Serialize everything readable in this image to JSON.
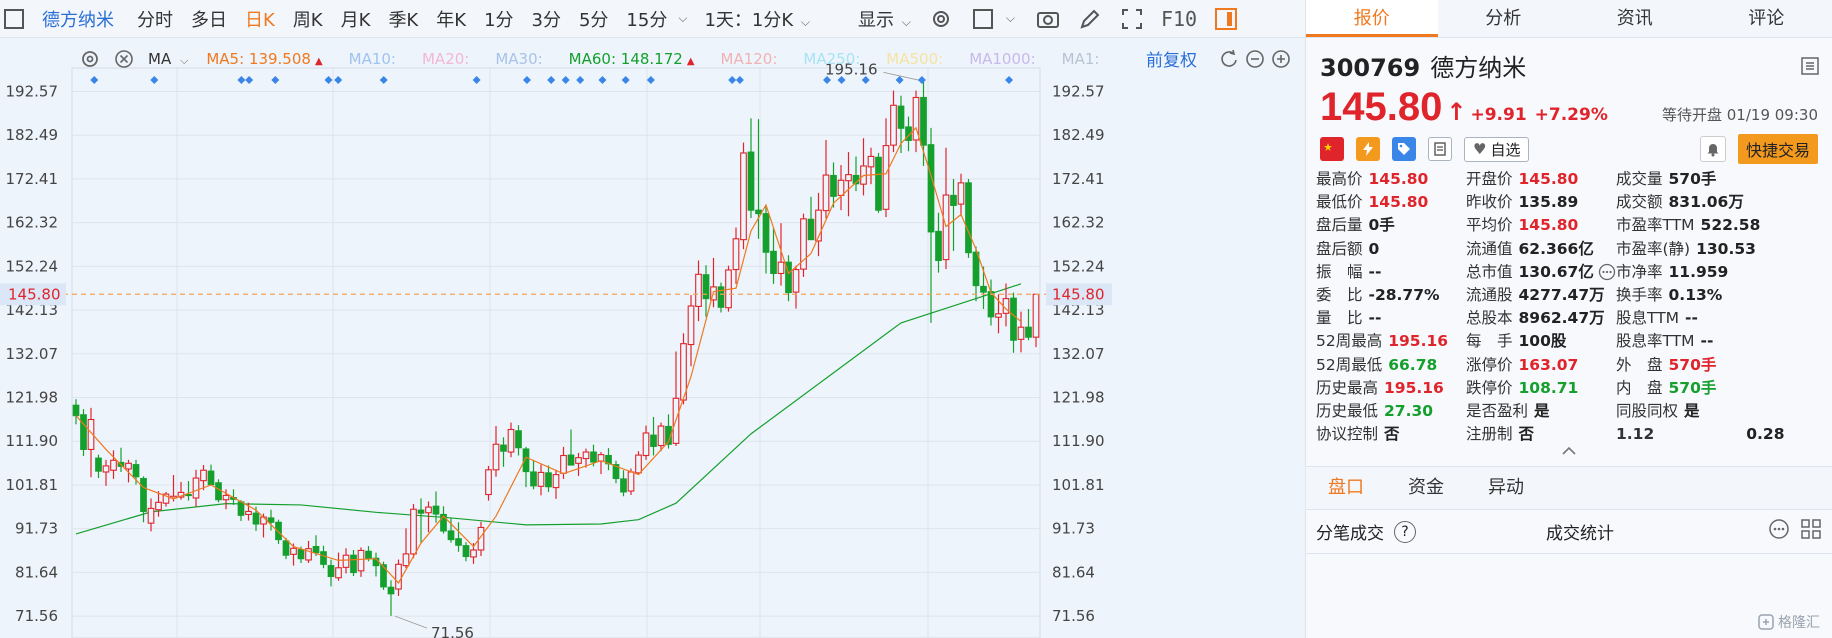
{
  "toolbar": {
    "stock_name": "德方纳米",
    "periods": [
      "分时",
      "多日",
      "日K",
      "周K",
      "月K",
      "季K",
      "年K",
      "1分",
      "3分",
      "5分",
      "15分"
    ],
    "active_period": "日K",
    "range_select": "1天：1分K",
    "display_label": "显示",
    "f10_label": "F10"
  },
  "ma_bar": {
    "indicator": "MA",
    "items": [
      {
        "label": "MA5: 139.508",
        "color": "#f0791f",
        "up": true
      },
      {
        "label": "MA10:",
        "color": "#9fc3f0"
      },
      {
        "label": "MA20:",
        "color": "#f2b6d9"
      },
      {
        "label": "MA30:",
        "color": "#a8c3e8"
      },
      {
        "label": "MA60: 148.172",
        "color": "#15a02e",
        "up": true
      },
      {
        "label": "MA120:",
        "color": "#f0b3b3"
      },
      {
        "label": "MA250:",
        "color": "#a6e3f5"
      },
      {
        "label": "MA500:",
        "color": "#f5e3a0"
      },
      {
        "label": "MA1000:",
        "color": "#c8b8ec"
      },
      {
        "label": "MA1:",
        "color": "#b8c4d4"
      }
    ],
    "fq_label": "前复权"
  },
  "chart_data": {
    "type": "candlestick",
    "y_ticks": [
      "192.57",
      "182.49",
      "172.41",
      "162.32",
      "152.24",
      "142.13",
      "132.07",
      "121.98",
      "111.90",
      "101.81",
      "91.73",
      "81.64",
      "71.56"
    ],
    "ylim": [
      66.5,
      198
    ],
    "current_price": "145.80",
    "annotations": [
      {
        "text": "195.16",
        "value": 195.16
      },
      {
        "text": "71.56",
        "value": 71.56
      }
    ],
    "ohlc": [
      [
        120.2,
        121.6,
        115.8,
        117.8
      ],
      [
        118,
        119.3,
        108.5,
        110
      ],
      [
        110,
        119.6,
        103.6,
        116.9
      ],
      [
        108,
        108.8,
        103.4,
        105
      ],
      [
        104.8,
        107.6,
        101.6,
        106.2
      ],
      [
        105.2,
        109.8,
        103.2,
        107.5
      ],
      [
        107,
        110.4,
        104.8,
        106.1
      ],
      [
        105.5,
        107.6,
        102.4,
        106.8
      ],
      [
        106.5,
        107.6,
        101.9,
        103.7
      ],
      [
        103.3,
        103.8,
        93.2,
        95.7
      ],
      [
        93,
        98.7,
        91.1,
        96.4
      ],
      [
        96.1,
        100.4,
        94.5,
        97.8
      ],
      [
        97.6,
        100.2,
        96.8,
        99.7
      ],
      [
        98.8,
        104.1,
        98,
        99.2
      ],
      [
        99,
        102.5,
        98.4,
        100.1
      ],
      [
        99.6,
        102.7,
        98.2,
        99.5
      ],
      [
        98.8,
        105.3,
        96.8,
        103.4
      ],
      [
        102.8,
        106.4,
        100.6,
        105.2
      ],
      [
        105,
        106.5,
        102.6,
        101.9
      ],
      [
        102.3,
        103.1,
        97.8,
        98.4
      ],
      [
        98.4,
        100.8,
        96.2,
        99.4
      ],
      [
        98.9,
        100.8,
        97.2,
        98.5
      ],
      [
        97.9,
        98.3,
        93.5,
        94.8
      ],
      [
        95,
        97.7,
        93.6,
        95.7
      ],
      [
        95.3,
        96.8,
        91.2,
        92.8
      ],
      [
        92.8,
        95.2,
        89.7,
        94.4
      ],
      [
        94.2,
        96.1,
        91.3,
        93.2
      ],
      [
        93.2,
        93.8,
        88.2,
        89.2
      ],
      [
        88.9,
        89.6,
        84.7,
        85.6
      ],
      [
        85.8,
        88.3,
        83.2,
        87.2
      ],
      [
        86.9,
        87.6,
        83.8,
        84.8
      ],
      [
        84.5,
        88.9,
        83.8,
        87.1
      ],
      [
        87.6,
        90.2,
        85.4,
        86.2
      ],
      [
        86.4,
        87.8,
        82.6,
        83.5
      ],
      [
        83.2,
        84.6,
        78.4,
        80.7
      ],
      [
        80.4,
        86.2,
        79.7,
        82.7
      ],
      [
        82.8,
        87.2,
        81.4,
        85.6
      ],
      [
        85.6,
        86.8,
        80.8,
        81.6
      ],
      [
        82,
        87.4,
        80.6,
        86.7
      ],
      [
        86.5,
        87.7,
        84.2,
        84.8
      ],
      [
        84.9,
        86.2,
        80.7,
        83.2
      ],
      [
        83.4,
        84.1,
        77.6,
        78.3
      ],
      [
        78.2,
        79.8,
        71.6,
        76.7
      ],
      [
        77.8,
        84.6,
        76.2,
        83.5
      ],
      [
        83.2,
        91.8,
        82.6,
        85.9
      ],
      [
        85.9,
        97.4,
        84.9,
        96.2
      ],
      [
        96,
        98.7,
        88.5,
        95.3
      ],
      [
        95.4,
        98,
        90.9,
        96.7
      ],
      [
        96.9,
        100.3,
        93.1,
        95.1
      ],
      [
        95,
        96.9,
        90.6,
        91.2
      ],
      [
        91.2,
        94.1,
        88.5,
        89.2
      ],
      [
        89.4,
        93.2,
        86.4,
        87.9
      ],
      [
        87.8,
        88.6,
        84.2,
        85.3
      ],
      [
        85.2,
        88.4,
        83.6,
        86.8
      ],
      [
        86.8,
        93.3,
        85.4,
        92
      ],
      [
        99.6,
        106.2,
        98.2,
        105.3
      ],
      [
        105.3,
        115.4,
        103.7,
        111.2
      ],
      [
        111,
        112.8,
        106,
        109.6
      ],
      [
        109.4,
        116.2,
        108.2,
        114.6
      ],
      [
        114.3,
        115.6,
        108.6,
        110.4
      ],
      [
        110.1,
        110.6,
        101.3,
        104.9
      ],
      [
        104.8,
        107.6,
        100.8,
        101.6
      ],
      [
        101.5,
        106.5,
        99.4,
        104.7
      ],
      [
        104.6,
        106.3,
        100.2,
        101.4
      ],
      [
        101.2,
        105.3,
        98.6,
        104.2
      ],
      [
        104.5,
        110.6,
        103.2,
        108.6
      ],
      [
        108.7,
        114.6,
        107.2,
        106.4
      ],
      [
        106.8,
        109.2,
        103.9,
        108.1
      ],
      [
        107.9,
        110.2,
        105.8,
        109.4
      ],
      [
        109.4,
        111.1,
        106.1,
        107.1
      ],
      [
        107.3,
        109.4,
        104.3,
        108.8
      ],
      [
        108.6,
        110.3,
        105.2,
        106.7
      ],
      [
        106.5,
        107.4,
        102.2,
        103.3
      ],
      [
        103.2,
        105.2,
        99.2,
        100.2
      ],
      [
        100.4,
        105.6,
        99.5,
        104.8
      ],
      [
        104.6,
        109.6,
        104.2,
        108.7
      ],
      [
        108.6,
        115.5,
        107.6,
        113.8
      ],
      [
        113.3,
        117.5,
        108.6,
        110.7
      ],
      [
        110.9,
        116.2,
        109.6,
        115.4
      ],
      [
        115.3,
        118.1,
        110.2,
        111.2
      ],
      [
        111.4,
        132.6,
        110.8,
        121.8
      ],
      [
        121.4,
        136.8,
        120.4,
        134.4
      ],
      [
        134.2,
        145.6,
        129.2,
        143.1
      ],
      [
        143,
        153.6,
        139.6,
        150.4
      ],
      [
        150.3,
        152.5,
        140.6,
        144.8
      ],
      [
        144.5,
        154.2,
        142.8,
        147.5
      ],
      [
        147.5,
        148.5,
        141.6,
        142.8
      ],
      [
        142.7,
        152.4,
        141.8,
        151.4
      ],
      [
        151.5,
        161.2,
        148.2,
        158.6
      ],
      [
        158.4,
        180.8,
        156.2,
        178.4
      ],
      [
        178.6,
        186.4,
        163.4,
        165.2
      ],
      [
        165.2,
        186.2,
        158.6,
        164.4
      ],
      [
        164.4,
        166.2,
        150.6,
        155.5
      ],
      [
        155.7,
        161.2,
        148.2,
        150.6
      ],
      [
        150.6,
        162.2,
        147.8,
        153.2
      ],
      [
        153.2,
        154.8,
        144.2,
        146.2
      ],
      [
        146.3,
        152.4,
        142.5,
        151.5
      ],
      [
        151.6,
        164.4,
        149.8,
        163.2
      ],
      [
        163.1,
        168.3,
        159.6,
        158.4
      ],
      [
        158.1,
        169.2,
        154.6,
        165.2
      ],
      [
        165.1,
        181.4,
        163.3,
        173.3
      ],
      [
        173.2,
        176.2,
        165.8,
        168.4
      ],
      [
        168.6,
        175.6,
        165.2,
        172.1
      ],
      [
        172,
        178.6,
        163.8,
        173.4
      ],
      [
        173.2,
        177.6,
        169.6,
        171.3
      ],
      [
        171.2,
        181.8,
        168.6,
        175.4
      ],
      [
        175.2,
        179.6,
        171.2,
        177.6
      ],
      [
        177.4,
        178.4,
        164.6,
        165.2
      ],
      [
        165.4,
        186.4,
        163.6,
        180.1
      ],
      [
        180.2,
        192.8,
        178.6,
        189.4
      ],
      [
        189.2,
        191.6,
        178.4,
        184.1
      ],
      [
        184.4,
        186.8,
        178.8,
        181.3
      ],
      [
        181.4,
        192.8,
        178.6,
        191.2
      ],
      [
        191.2,
        195.2,
        175.4,
        180.2
      ],
      [
        180.3,
        184.2,
        139.2,
        160.2
      ],
      [
        160.3,
        164.6,
        150.8,
        153.6
      ],
      [
        153.8,
        179.6,
        151.6,
        168.7
      ],
      [
        168.6,
        172.4,
        155.8,
        166.3
      ],
      [
        166.6,
        173.6,
        163.8,
        171.5
      ],
      [
        171.5,
        172.4,
        154.2,
        155.4
      ],
      [
        155.5,
        156.8,
        144.2,
        147.8
      ],
      [
        147.6,
        152.2,
        142.4,
        146.3
      ],
      [
        146.4,
        149.2,
        138.6,
        140.6
      ],
      [
        140.5,
        145.8,
        136.8,
        141.3
      ],
      [
        141.4,
        148.3,
        138.4,
        144.8
      ],
      [
        144.9,
        146.2,
        132.3,
        135.2
      ],
      [
        135.4,
        141.8,
        132.4,
        138.2
      ],
      [
        138.2,
        142.4,
        135.2,
        135.9
      ],
      [
        135.9,
        145.8,
        133.6,
        145.8
      ]
    ],
    "ma5_points": [
      [
        0,
        117.8
      ],
      [
        4,
        110
      ],
      [
        9,
        101.2
      ],
      [
        13,
        98.6
      ],
      [
        18,
        101.8
      ],
      [
        24,
        96
      ],
      [
        29,
        87.6
      ],
      [
        35,
        84.4
      ],
      [
        40,
        84.8
      ],
      [
        43,
        79.2
      ],
      [
        46,
        88.4
      ],
      [
        49,
        94.6
      ],
      [
        53,
        87.6
      ],
      [
        56,
        94.6
      ],
      [
        60,
        108.2
      ],
      [
        65,
        104.4
      ],
      [
        70,
        107.4
      ],
      [
        75,
        104.2
      ],
      [
        79,
        111.8
      ],
      [
        82,
        126.8
      ],
      [
        85,
        146.4
      ],
      [
        88,
        147.2
      ],
      [
        90,
        160.4
      ],
      [
        92,
        166.4
      ],
      [
        95,
        150.6
      ],
      [
        98,
        155.2
      ],
      [
        101,
        166.8
      ],
      [
        105,
        173.2
      ],
      [
        108,
        173.6
      ],
      [
        110,
        180.6
      ],
      [
        112,
        184.2
      ],
      [
        114,
        173.2
      ],
      [
        116,
        161.4
      ],
      [
        118,
        164.2
      ],
      [
        120,
        156.2
      ],
      [
        122,
        146.2
      ],
      [
        124,
        142.4
      ],
      [
        126,
        139.5
      ]
    ],
    "ma60_points": [
      [
        0,
        90.5
      ],
      [
        10,
        95.6
      ],
      [
        20,
        97.5
      ],
      [
        30,
        97.2
      ],
      [
        40,
        95.5
      ],
      [
        50,
        94.2
      ],
      [
        60,
        92.6
      ],
      [
        70,
        92.8
      ],
      [
        75,
        93.8
      ],
      [
        80,
        97.6
      ],
      [
        90,
        113.6
      ],
      [
        100,
        126.4
      ],
      [
        110,
        139.2
      ],
      [
        120,
        144.8
      ],
      [
        126,
        148.2
      ]
    ],
    "event_markers_x": [
      0.023,
      0.085,
      0.175,
      0.183,
      0.21,
      0.265,
      0.275,
      0.322,
      0.418,
      0.47,
      0.495,
      0.51,
      0.525,
      0.548,
      0.572,
      0.598,
      0.682,
      0.69,
      0.78,
      0.795,
      0.82,
      0.855,
      0.878,
      0.968
    ]
  },
  "panel": {
    "tabs": [
      "报价",
      "分析",
      "资讯",
      "评论"
    ],
    "active_tab": "报价",
    "code": "300769",
    "name": "德方纳米",
    "price": "145.80",
    "change": "+9.91",
    "change_pct": "+7.29%",
    "status": "等待开盘 01/19 09:30",
    "watch_label": "自选",
    "trade_label": "快捷交易",
    "quotes": [
      {
        "label": "最高价",
        "value": "145.80",
        "color": "red"
      },
      {
        "label": "开盘价",
        "value": "145.80",
        "color": "red"
      },
      {
        "label": "成交量",
        "value": "570手",
        "color": ""
      },
      {
        "label": "最低价",
        "value": "145.80",
        "color": "red"
      },
      {
        "label": "昨收价",
        "value": "135.89",
        "color": ""
      },
      {
        "label": "成交额",
        "value": "831.06万",
        "color": ""
      },
      {
        "label": "盘后量",
        "value": "0手",
        "color": ""
      },
      {
        "label": "平均价",
        "value": "145.80",
        "color": "red"
      },
      {
        "label": "市盈率TTM",
        "value": "522.58",
        "color": ""
      },
      {
        "label": "盘后额",
        "value": "0",
        "color": ""
      },
      {
        "label": "流通值",
        "value": "62.366亿",
        "color": ""
      },
      {
        "label": "市盈率(静)",
        "value": "130.53",
        "color": ""
      },
      {
        "label": "振　幅",
        "value": "--",
        "color": ""
      },
      {
        "label": "总市值",
        "value": "130.67亿",
        "color": "",
        "more": true
      },
      {
        "label": "市净率",
        "value": "11.959",
        "color": ""
      },
      {
        "label": "委　比",
        "value": "-28.77%",
        "color": ""
      },
      {
        "label": "流通股",
        "value": "4277.47万",
        "color": ""
      },
      {
        "label": "换手率",
        "value": "0.13%",
        "color": ""
      },
      {
        "label": "量　比",
        "value": "--",
        "color": ""
      },
      {
        "label": "总股本",
        "value": "8962.47万",
        "color": ""
      },
      {
        "label": "股息TTM",
        "value": "--",
        "color": ""
      },
      {
        "label": "52周最高",
        "value": "195.16",
        "color": "red"
      },
      {
        "label": "每　手",
        "value": "100股",
        "color": ""
      },
      {
        "label": "股息率TTM",
        "value": "--",
        "color": ""
      },
      {
        "label": "52周最低",
        "value": "66.78",
        "color": "green"
      },
      {
        "label": "涨停价",
        "value": "163.07",
        "color": "red"
      },
      {
        "label": "外　盘",
        "value": "570手",
        "color": "red"
      },
      {
        "label": "历史最高",
        "value": "195.16",
        "color": "red"
      },
      {
        "label": "跌停价",
        "value": "108.71",
        "color": "green"
      },
      {
        "label": "内　盘",
        "value": "570手",
        "color": "green"
      },
      {
        "label": "历史最低",
        "value": "27.30",
        "color": "green"
      },
      {
        "label": "是否盈利",
        "value": "是",
        "color": ""
      },
      {
        "label": "同股同权",
        "value": "是",
        "color": ""
      },
      {
        "label": "协议控制",
        "value": "否",
        "color": ""
      },
      {
        "label": "注册制",
        "value": "否",
        "color": ""
      },
      {
        "label": "1.12",
        "value": "0.28",
        "color": ""
      }
    ],
    "sub_tabs": [
      "盘口",
      "资金",
      "异动"
    ],
    "active_sub_tab": "盘口",
    "trade_detail_label": "分笔成交",
    "trade_stats_label": "成交统计",
    "watermark": "格隆汇"
  },
  "colors": {
    "up": "#e0242b",
    "down": "#15a02e",
    "ma5": "#f0791f",
    "ma60": "#15a02e",
    "accent": "#f0791f",
    "link": "#2a6fd6"
  }
}
